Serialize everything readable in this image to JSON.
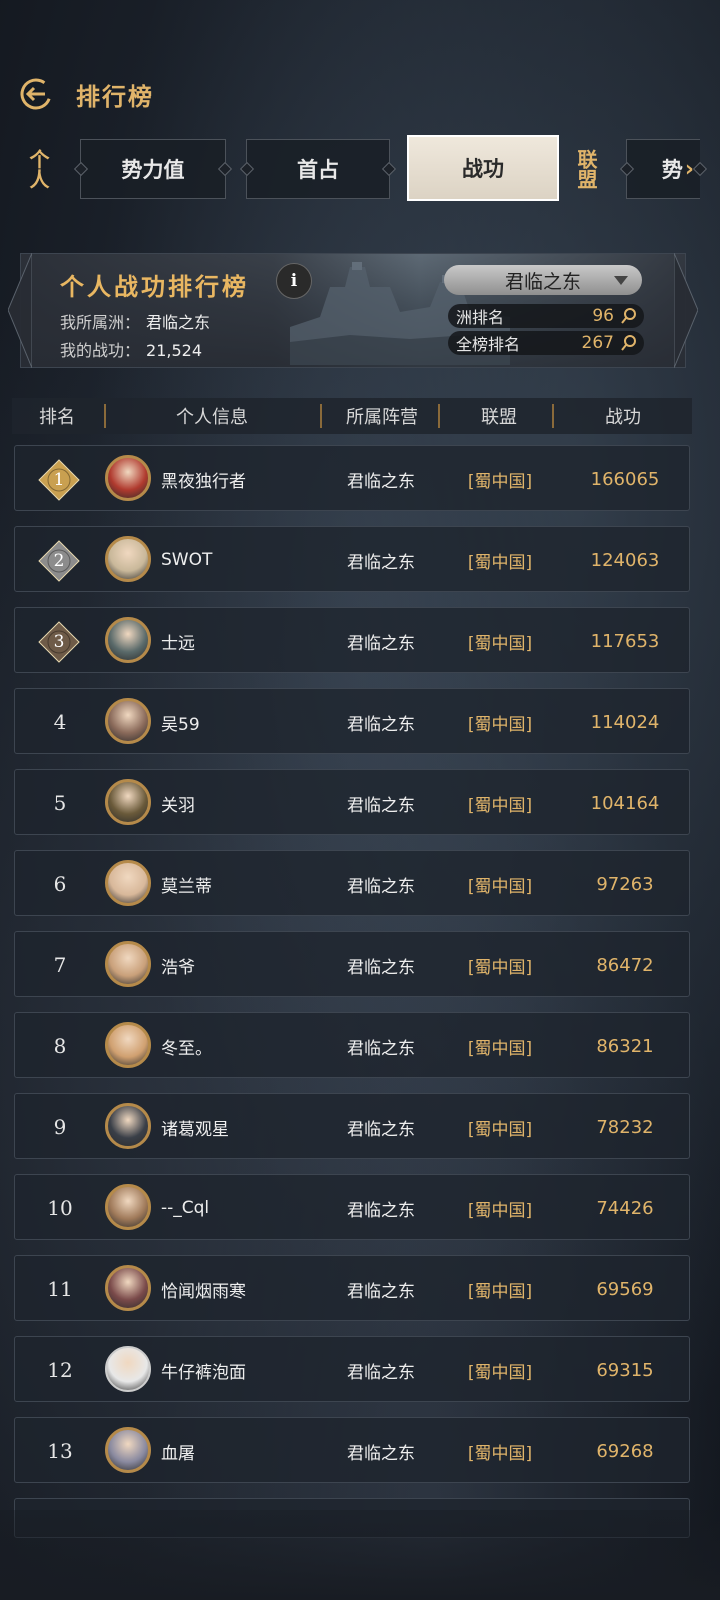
{
  "header": {
    "title": "排行榜"
  },
  "tabs": {
    "personal": "个人",
    "power": "势力值",
    "first_occupy": "首占",
    "merit": "战功",
    "alliance": "联盟",
    "partial": "势"
  },
  "banner": {
    "title": "个人战功排行榜",
    "info": "i",
    "region_label": "我所属洲：",
    "region_value": "君临之东",
    "merit_label": "我的战功：",
    "merit_value": "21,524",
    "selector": "君临之东",
    "region_rank_label": "洲排名",
    "region_rank": "96",
    "total_rank_label": "全榜排名",
    "total_rank": "267"
  },
  "columns": [
    "排名",
    "个人信息",
    "所属阵营",
    "联盟",
    "战功"
  ],
  "rows": [
    {
      "rank": "1",
      "name": "黑夜独行者",
      "faction": "君临之东",
      "alliance": "[蜀中国]",
      "merit": "166065",
      "avatar": "#b03a2e"
    },
    {
      "rank": "2",
      "name": "SWOT",
      "faction": "君临之东",
      "alliance": "[蜀中国]",
      "merit": "124063",
      "avatar": "#c9b89a"
    },
    {
      "rank": "3",
      "name": "士远",
      "faction": "君临之东",
      "alliance": "[蜀中国]",
      "merit": "117653",
      "avatar": "#5a6a6a"
    },
    {
      "rank": "4",
      "name": "吴59",
      "faction": "君临之东",
      "alliance": "[蜀中国]",
      "merit": "114024",
      "avatar": "#8a6a5a"
    },
    {
      "rank": "5",
      "name": "关羽",
      "faction": "君临之东",
      "alliance": "[蜀中国]",
      "merit": "104164",
      "avatar": "#6a5a3a"
    },
    {
      "rank": "6",
      "name": "莫兰蒂",
      "faction": "君临之东",
      "alliance": "[蜀中国]",
      "merit": "97263",
      "avatar": "#d8b89a"
    },
    {
      "rank": "7",
      "name": "浩爷",
      "faction": "君临之东",
      "alliance": "[蜀中国]",
      "merit": "86472",
      "avatar": "#c9a07a"
    },
    {
      "rank": "8",
      "name": "冬至。",
      "faction": "君临之东",
      "alliance": "[蜀中国]",
      "merit": "86321",
      "avatar": "#d0a070"
    },
    {
      "rank": "9",
      "name": "诸葛观星",
      "faction": "君临之东",
      "alliance": "[蜀中国]",
      "merit": "78232",
      "avatar": "#3a3f48"
    },
    {
      "rank": "10",
      "name": "--_Cql",
      "faction": "君临之东",
      "alliance": "[蜀中国]",
      "merit": "74426",
      "avatar": "#a07a5a"
    },
    {
      "rank": "11",
      "name": "恰闻烟雨寒",
      "faction": "君临之东",
      "alliance": "[蜀中国]",
      "merit": "69569",
      "avatar": "#7a4a4a"
    },
    {
      "rank": "12",
      "name": "牛仔裤泡面",
      "faction": "君临之东",
      "alliance": "[蜀中国]",
      "merit": "69315",
      "avatar": "#e8e8e8"
    },
    {
      "rank": "13",
      "name": "血屠",
      "faction": "君临之东",
      "alliance": "[蜀中国]",
      "merit": "69268",
      "avatar": "#8a8aa0"
    }
  ],
  "colors": {
    "gold": "#e0b46a",
    "medal_gold": "#c9a050",
    "medal_silver": "#8c8c8c",
    "medal_bronze": "#6e5b48"
  }
}
